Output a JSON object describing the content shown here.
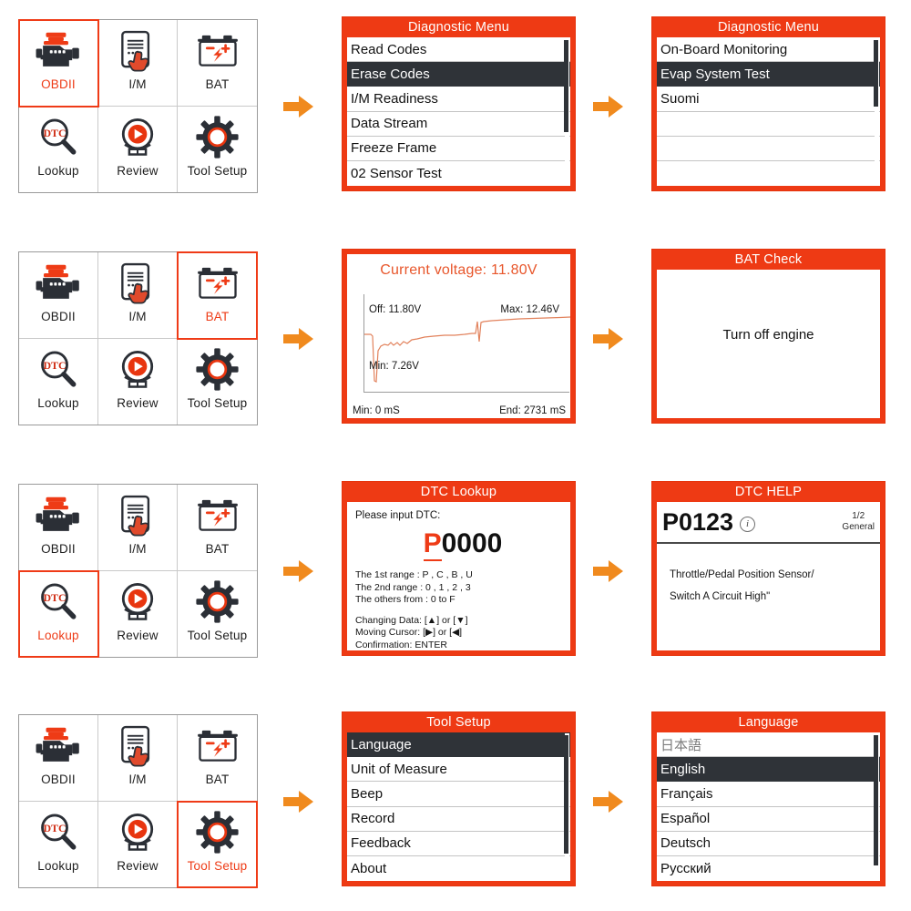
{
  "meta": {
    "accent_red": "#ee3a14",
    "accent_orange": "#f08a1e",
    "highlight_dark": "#2f3338",
    "graph_line": "#e2825c"
  },
  "grid": {
    "items": [
      {
        "label": "OBDII",
        "icon": "engine-icon"
      },
      {
        "label": "I/M",
        "icon": "tablet-hand-icon"
      },
      {
        "label": "BAT",
        "icon": "battery-icon"
      },
      {
        "label": "Lookup",
        "icon": "dtc-magnifier-icon"
      },
      {
        "label": "Review",
        "icon": "play-monitor-icon"
      },
      {
        "label": "Tool Setup",
        "icon": "gear-icon"
      }
    ]
  },
  "rows": [
    {
      "name": "obdii-flow",
      "selected": "OBDII",
      "screen_a": {
        "title": "Diagnostic Menu",
        "type": "menu",
        "items": [
          {
            "label": "Read Codes",
            "highlighted": false
          },
          {
            "label": "Erase Codes",
            "highlighted": true
          },
          {
            "label": "I/M Readiness",
            "highlighted": false
          },
          {
            "label": "Data Stream",
            "highlighted": false
          },
          {
            "label": "Freeze Frame",
            "highlighted": false
          },
          {
            "label": "02 Sensor Test",
            "highlighted": false
          }
        ],
        "scroll": {
          "top_pct": 1,
          "height_pct": 62
        }
      },
      "screen_b": {
        "title": "Diagnostic Menu",
        "type": "menu",
        "items": [
          {
            "label": "On-Board Monitoring",
            "highlighted": false
          },
          {
            "label": "Evap System Test",
            "highlighted": true
          },
          {
            "label": "Suomi",
            "highlighted": false
          },
          {
            "label": "",
            "highlighted": false
          },
          {
            "label": "",
            "highlighted": false
          },
          {
            "label": "",
            "highlighted": false
          }
        ],
        "scroll": {
          "top_pct": 1,
          "height_pct": 45
        }
      }
    },
    {
      "name": "bat-flow",
      "selected": "BAT",
      "screen_a": {
        "type": "battery-graph",
        "heading": "Current voltage: 11.80V",
        "label_off": "Off: 11.80V",
        "label_max": "Max: 12.46V",
        "label_min": "Min: 7.26V",
        "label_time_start": "Min: 0 mS",
        "label_time_end": "End: 2731 mS"
      },
      "screen_b": {
        "title": "BAT Check",
        "type": "message",
        "message": "Turn off engine"
      }
    },
    {
      "name": "lookup-flow",
      "selected": "Lookup",
      "screen_a": {
        "title": "DTC Lookup",
        "type": "dtc-input",
        "prompt": "Please input DTC:",
        "code_first": "P",
        "code_rest": "0000",
        "rules": [
          "The 1st range : P , C , B , U",
          "The 2nd range : 0 , 1 , 2 , 3",
          "The others from : 0 to F"
        ],
        "keys": [
          "Changing Data: [▲]  or [▼]",
          "Moving Cursor:  [▶] or  [◀]",
          "Confirmation:  ENTER"
        ]
      },
      "screen_b": {
        "title": "DTC HELP",
        "type": "dtc-help",
        "code": "P0123",
        "info_icon": "info-icon",
        "page": "1/2",
        "scope": "General",
        "description_lines": [
          "Throttle/Pedal Position Sensor/",
          "Switch A Circuit High\""
        ]
      }
    },
    {
      "name": "tool-setup-flow",
      "selected": "Tool Setup",
      "screen_a": {
        "title": "Tool Setup",
        "type": "menu",
        "items": [
          {
            "label": "Language",
            "highlighted": true
          },
          {
            "label": "Unit of Measure",
            "highlighted": false
          },
          {
            "label": "Beep",
            "highlighted": false
          },
          {
            "label": "Record",
            "highlighted": false
          },
          {
            "label": "Feedback",
            "highlighted": false
          },
          {
            "label": "About",
            "highlighted": false
          }
        ],
        "scroll": {
          "top_pct": 1,
          "height_pct": 80
        }
      },
      "screen_b": {
        "title": "Language",
        "type": "menu",
        "items": [
          {
            "label": "日本語",
            "highlighted": false,
            "dim": true
          },
          {
            "label": "English",
            "highlighted": true
          },
          {
            "label": "Français",
            "highlighted": false
          },
          {
            "label": "Español",
            "highlighted": false
          },
          {
            "label": "Deutsch",
            "highlighted": false
          },
          {
            "label": "Русский",
            "highlighted": false
          }
        ],
        "scroll": {
          "top_pct": 1,
          "height_pct": 88
        }
      }
    }
  ],
  "arrow_label": "flow-arrow-right"
}
